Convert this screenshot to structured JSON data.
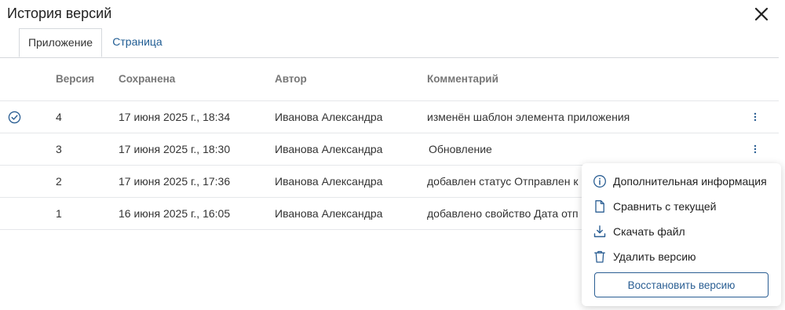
{
  "dialog": {
    "title": "История версий",
    "tabs": [
      {
        "label": "Приложение",
        "active": true
      },
      {
        "label": "Страница",
        "active": false
      }
    ]
  },
  "table": {
    "headers": {
      "version": "Версия",
      "saved": "Сохранена",
      "author": "Автор",
      "comment": "Комментарий"
    },
    "rows": [
      {
        "version": "4",
        "saved": "17 июня 2025 г., 18:34",
        "author": "Иванова Александра",
        "comment": "изменён шаблон элемента приложения",
        "current": true
      },
      {
        "version": "3",
        "saved": "17 июня 2025 г., 18:30",
        "author": "Иванова Александра",
        "comment": "Обновление",
        "current": false
      },
      {
        "version": "2",
        "saved": "17 июня 2025 г., 17:36",
        "author": "Иванова Александра",
        "comment": "добавлен статус Отправлен к",
        "current": false
      },
      {
        "version": "1",
        "saved": "16 июня 2025 г., 16:05",
        "author": "Иванова Александра",
        "comment": "добавлено свойство Дата отп",
        "current": false
      }
    ]
  },
  "context_menu": {
    "items": [
      {
        "label": "Дополнительная информация",
        "icon": "info-icon"
      },
      {
        "label": "Сравнить с текущей",
        "icon": "document-icon"
      },
      {
        "label": "Скачать файл",
        "icon": "download-icon"
      },
      {
        "label": "Удалить версию",
        "icon": "trash-icon"
      }
    ],
    "restore_label": "Восстановить версию"
  },
  "colors": {
    "accent": "#1f5c93",
    "border": "#d5d8dc"
  }
}
